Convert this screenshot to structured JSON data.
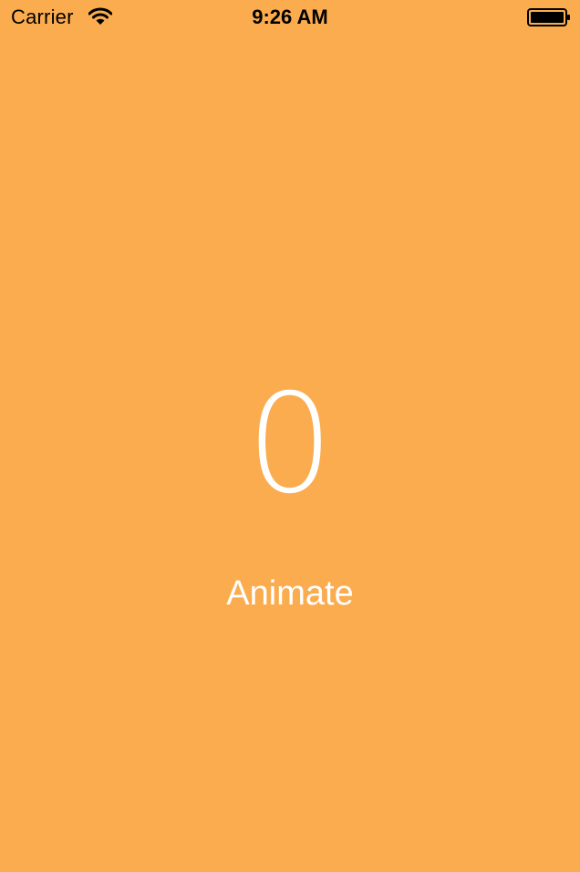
{
  "status_bar": {
    "carrier": "Carrier",
    "time": "9:26 AM",
    "wifi_icon": "wifi-icon",
    "battery_icon": "battery-icon",
    "battery_level": 1.0
  },
  "main": {
    "counter_value": "0",
    "animate_label": "Animate"
  },
  "colors": {
    "background": "#FBAC4F",
    "foreground": "#FFFFFF",
    "status_text": "#000000"
  }
}
